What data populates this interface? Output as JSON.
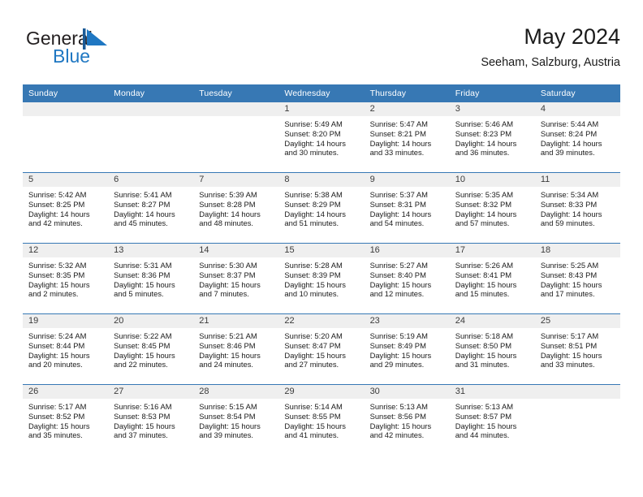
{
  "brand": {
    "name_part1": "General",
    "name_part2": "Blue",
    "logo_icon": "triangle-mark-icon",
    "accent_color": "#1f77c2"
  },
  "header": {
    "title": "May 2024",
    "location": "Seeham, Salzburg, Austria"
  },
  "theme": {
    "header_row_bg": "#3778b4",
    "day_band_bg": "#efefef",
    "row_divider": "#3778b4"
  },
  "weekday_headers": [
    "Sunday",
    "Monday",
    "Tuesday",
    "Wednesday",
    "Thursday",
    "Friday",
    "Saturday"
  ],
  "weeks": [
    {
      "days": [
        {
          "date": "",
          "empty": true,
          "sunrise": "",
          "sunset": "",
          "daylight": ""
        },
        {
          "date": "",
          "empty": true,
          "sunrise": "",
          "sunset": "",
          "daylight": ""
        },
        {
          "date": "",
          "empty": true,
          "sunrise": "",
          "sunset": "",
          "daylight": ""
        },
        {
          "date": "1",
          "empty": false,
          "sunrise": "Sunrise: 5:49 AM",
          "sunset": "Sunset: 8:20 PM",
          "daylight": "Daylight: 14 hours and 30 minutes."
        },
        {
          "date": "2",
          "empty": false,
          "sunrise": "Sunrise: 5:47 AM",
          "sunset": "Sunset: 8:21 PM",
          "daylight": "Daylight: 14 hours and 33 minutes."
        },
        {
          "date": "3",
          "empty": false,
          "sunrise": "Sunrise: 5:46 AM",
          "sunset": "Sunset: 8:23 PM",
          "daylight": "Daylight: 14 hours and 36 minutes."
        },
        {
          "date": "4",
          "empty": false,
          "sunrise": "Sunrise: 5:44 AM",
          "sunset": "Sunset: 8:24 PM",
          "daylight": "Daylight: 14 hours and 39 minutes."
        }
      ]
    },
    {
      "days": [
        {
          "date": "5",
          "empty": false,
          "sunrise": "Sunrise: 5:42 AM",
          "sunset": "Sunset: 8:25 PM",
          "daylight": "Daylight: 14 hours and 42 minutes."
        },
        {
          "date": "6",
          "empty": false,
          "sunrise": "Sunrise: 5:41 AM",
          "sunset": "Sunset: 8:27 PM",
          "daylight": "Daylight: 14 hours and 45 minutes."
        },
        {
          "date": "7",
          "empty": false,
          "sunrise": "Sunrise: 5:39 AM",
          "sunset": "Sunset: 8:28 PM",
          "daylight": "Daylight: 14 hours and 48 minutes."
        },
        {
          "date": "8",
          "empty": false,
          "sunrise": "Sunrise: 5:38 AM",
          "sunset": "Sunset: 8:29 PM",
          "daylight": "Daylight: 14 hours and 51 minutes."
        },
        {
          "date": "9",
          "empty": false,
          "sunrise": "Sunrise: 5:37 AM",
          "sunset": "Sunset: 8:31 PM",
          "daylight": "Daylight: 14 hours and 54 minutes."
        },
        {
          "date": "10",
          "empty": false,
          "sunrise": "Sunrise: 5:35 AM",
          "sunset": "Sunset: 8:32 PM",
          "daylight": "Daylight: 14 hours and 57 minutes."
        },
        {
          "date": "11",
          "empty": false,
          "sunrise": "Sunrise: 5:34 AM",
          "sunset": "Sunset: 8:33 PM",
          "daylight": "Daylight: 14 hours and 59 minutes."
        }
      ]
    },
    {
      "days": [
        {
          "date": "12",
          "empty": false,
          "sunrise": "Sunrise: 5:32 AM",
          "sunset": "Sunset: 8:35 PM",
          "daylight": "Daylight: 15 hours and 2 minutes."
        },
        {
          "date": "13",
          "empty": false,
          "sunrise": "Sunrise: 5:31 AM",
          "sunset": "Sunset: 8:36 PM",
          "daylight": "Daylight: 15 hours and 5 minutes."
        },
        {
          "date": "14",
          "empty": false,
          "sunrise": "Sunrise: 5:30 AM",
          "sunset": "Sunset: 8:37 PM",
          "daylight": "Daylight: 15 hours and 7 minutes."
        },
        {
          "date": "15",
          "empty": false,
          "sunrise": "Sunrise: 5:28 AM",
          "sunset": "Sunset: 8:39 PM",
          "daylight": "Daylight: 15 hours and 10 minutes."
        },
        {
          "date": "16",
          "empty": false,
          "sunrise": "Sunrise: 5:27 AM",
          "sunset": "Sunset: 8:40 PM",
          "daylight": "Daylight: 15 hours and 12 minutes."
        },
        {
          "date": "17",
          "empty": false,
          "sunrise": "Sunrise: 5:26 AM",
          "sunset": "Sunset: 8:41 PM",
          "daylight": "Daylight: 15 hours and 15 minutes."
        },
        {
          "date": "18",
          "empty": false,
          "sunrise": "Sunrise: 5:25 AM",
          "sunset": "Sunset: 8:43 PM",
          "daylight": "Daylight: 15 hours and 17 minutes."
        }
      ]
    },
    {
      "days": [
        {
          "date": "19",
          "empty": false,
          "sunrise": "Sunrise: 5:24 AM",
          "sunset": "Sunset: 8:44 PM",
          "daylight": "Daylight: 15 hours and 20 minutes."
        },
        {
          "date": "20",
          "empty": false,
          "sunrise": "Sunrise: 5:22 AM",
          "sunset": "Sunset: 8:45 PM",
          "daylight": "Daylight: 15 hours and 22 minutes."
        },
        {
          "date": "21",
          "empty": false,
          "sunrise": "Sunrise: 5:21 AM",
          "sunset": "Sunset: 8:46 PM",
          "daylight": "Daylight: 15 hours and 24 minutes."
        },
        {
          "date": "22",
          "empty": false,
          "sunrise": "Sunrise: 5:20 AM",
          "sunset": "Sunset: 8:47 PM",
          "daylight": "Daylight: 15 hours and 27 minutes."
        },
        {
          "date": "23",
          "empty": false,
          "sunrise": "Sunrise: 5:19 AM",
          "sunset": "Sunset: 8:49 PM",
          "daylight": "Daylight: 15 hours and 29 minutes."
        },
        {
          "date": "24",
          "empty": false,
          "sunrise": "Sunrise: 5:18 AM",
          "sunset": "Sunset: 8:50 PM",
          "daylight": "Daylight: 15 hours and 31 minutes."
        },
        {
          "date": "25",
          "empty": false,
          "sunrise": "Sunrise: 5:17 AM",
          "sunset": "Sunset: 8:51 PM",
          "daylight": "Daylight: 15 hours and 33 minutes."
        }
      ]
    },
    {
      "days": [
        {
          "date": "26",
          "empty": false,
          "sunrise": "Sunrise: 5:17 AM",
          "sunset": "Sunset: 8:52 PM",
          "daylight": "Daylight: 15 hours and 35 minutes."
        },
        {
          "date": "27",
          "empty": false,
          "sunrise": "Sunrise: 5:16 AM",
          "sunset": "Sunset: 8:53 PM",
          "daylight": "Daylight: 15 hours and 37 minutes."
        },
        {
          "date": "28",
          "empty": false,
          "sunrise": "Sunrise: 5:15 AM",
          "sunset": "Sunset: 8:54 PM",
          "daylight": "Daylight: 15 hours and 39 minutes."
        },
        {
          "date": "29",
          "empty": false,
          "sunrise": "Sunrise: 5:14 AM",
          "sunset": "Sunset: 8:55 PM",
          "daylight": "Daylight: 15 hours and 41 minutes."
        },
        {
          "date": "30",
          "empty": false,
          "sunrise": "Sunrise: 5:13 AM",
          "sunset": "Sunset: 8:56 PM",
          "daylight": "Daylight: 15 hours and 42 minutes."
        },
        {
          "date": "31",
          "empty": false,
          "sunrise": "Sunrise: 5:13 AM",
          "sunset": "Sunset: 8:57 PM",
          "daylight": "Daylight: 15 hours and 44 minutes."
        },
        {
          "date": "",
          "empty": true,
          "sunrise": "",
          "sunset": "",
          "daylight": ""
        }
      ]
    }
  ]
}
